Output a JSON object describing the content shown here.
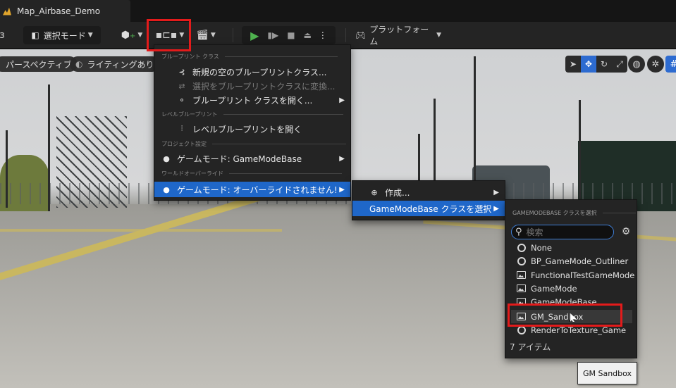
{
  "tab": {
    "title": "Map_Airbase_Demo"
  },
  "toolbar": {
    "mode_label": "選択モード",
    "platform_label": "プラットフォーム"
  },
  "viewport": {
    "perspective_label": "パースペクティブ",
    "lighting_label": "ライティングあり"
  },
  "blueprint_menu": {
    "sections": {
      "blueprint_class": "ブループリント クラス",
      "level_blueprint": "レベルブループリント",
      "project_settings": "プロジェクト設定",
      "world_override": "ワールドオーバーライド"
    },
    "items": {
      "new_blueprint": "新規の空のブループリントクラス...",
      "convert_selection": "選択をブループリントクラスに変換...",
      "open_blueprint": "ブループリント クラスを開く...",
      "open_level_blueprint": "レベルブループリントを開く",
      "gamemode_project": "ゲームモード: GameModeBase",
      "gamemode_override": "ゲームモード: オーバーライドされません!"
    }
  },
  "gamemode_submenu": {
    "create": "作成...",
    "select_class": "GameModeBase クラスを選択"
  },
  "class_picker": {
    "header": "GAMEMODEBASE クラスを選択",
    "search_placeholder": "検索",
    "items": [
      {
        "label": "None",
        "icon": "circle-icon"
      },
      {
        "label": "BP_GameMode_Outliner",
        "icon": "circle-icon"
      },
      {
        "label": "FunctionalTestGameMode",
        "icon": "class-image-icon"
      },
      {
        "label": "GameMode",
        "icon": "class-image-icon"
      },
      {
        "label": "GameModeBase",
        "icon": "class-image-icon"
      },
      {
        "label": "GM_Sandbox",
        "icon": "class-image-icon"
      },
      {
        "label": "RenderToTexture_Game",
        "icon": "circle-icon"
      }
    ],
    "count": "7 アイテム"
  },
  "tooltip": {
    "text": "GM Sandbox"
  },
  "colors": {
    "highlight": "#1f67c9",
    "annotation": "#e31b1b",
    "play": "#4fb24f"
  }
}
